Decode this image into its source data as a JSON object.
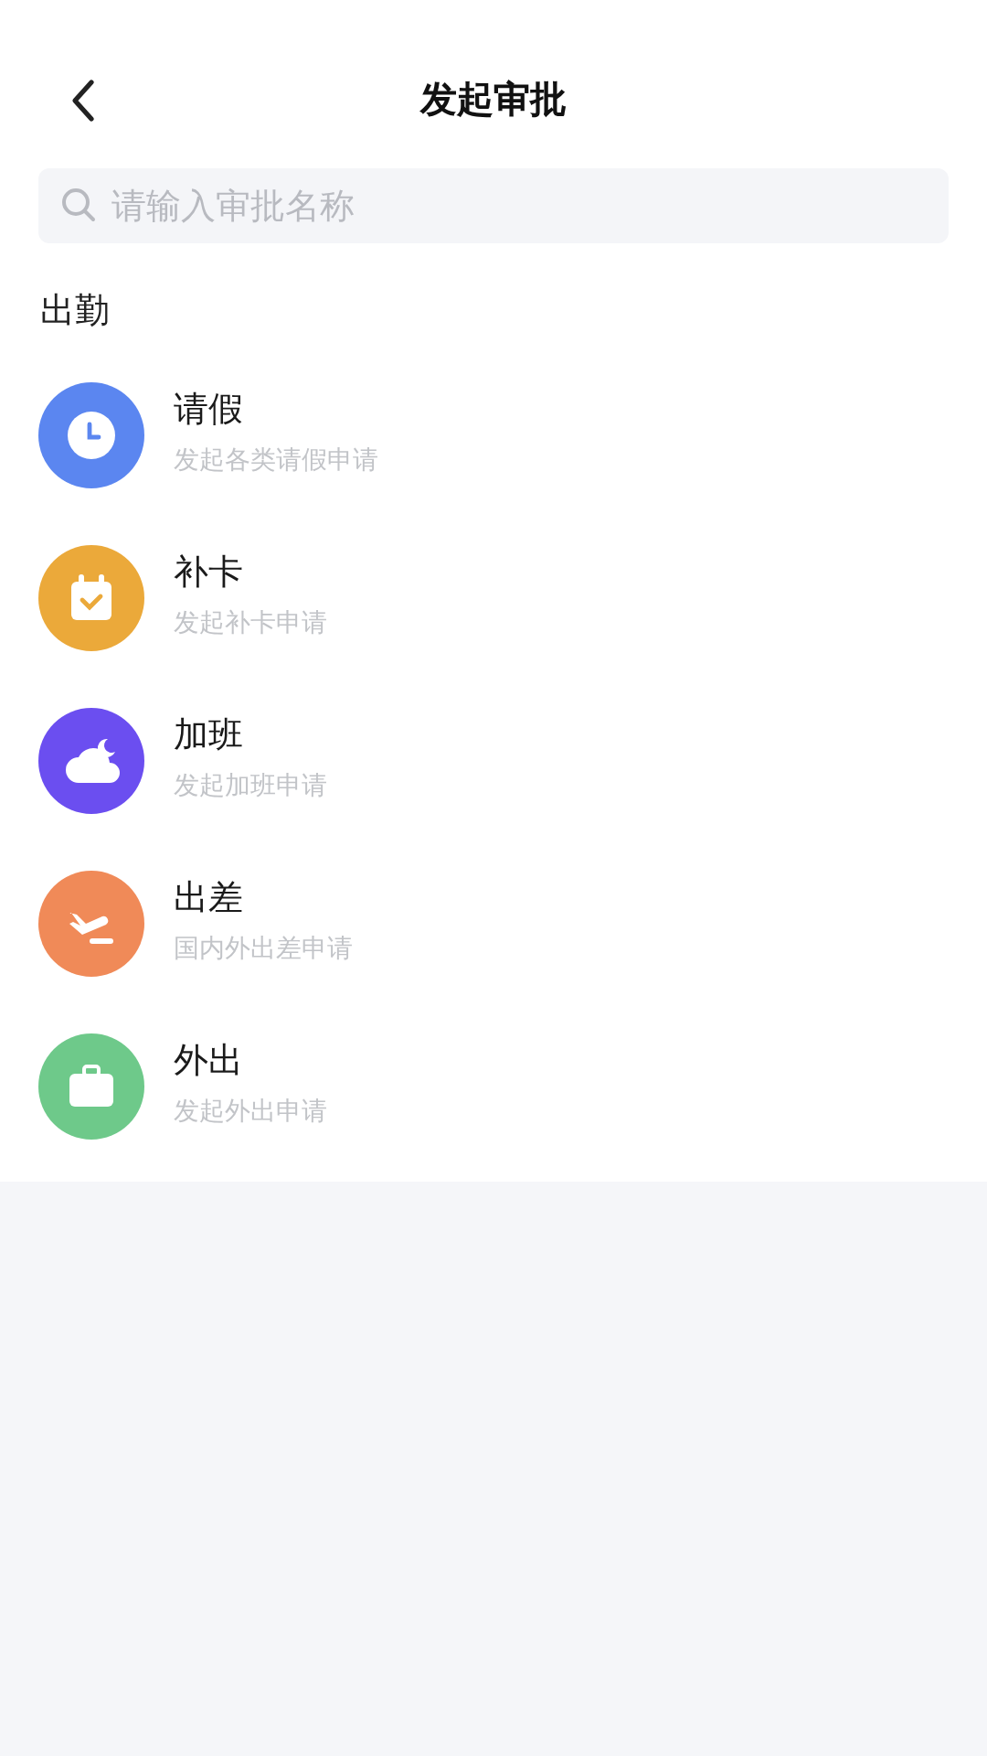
{
  "header": {
    "title": "发起审批"
  },
  "search": {
    "placeholder": "请输入审批名称"
  },
  "section": {
    "title": "出勤"
  },
  "items": [
    {
      "kind": "clock",
      "color": "#5b86f0",
      "title": "请假",
      "subtitle": "发起各类请假申请"
    },
    {
      "kind": "calendar",
      "color": "#eba93a",
      "title": "补卡",
      "subtitle": "发起补卡申请"
    },
    {
      "kind": "cloud",
      "color": "#6b4ef0",
      "title": "加班",
      "subtitle": "发起加班申请"
    },
    {
      "kind": "plane",
      "color": "#f08a58",
      "title": "出差",
      "subtitle": "国内外出差申请"
    },
    {
      "kind": "briefcase",
      "color": "#6ec98a",
      "title": "外出",
      "subtitle": "发起外出申请"
    }
  ]
}
